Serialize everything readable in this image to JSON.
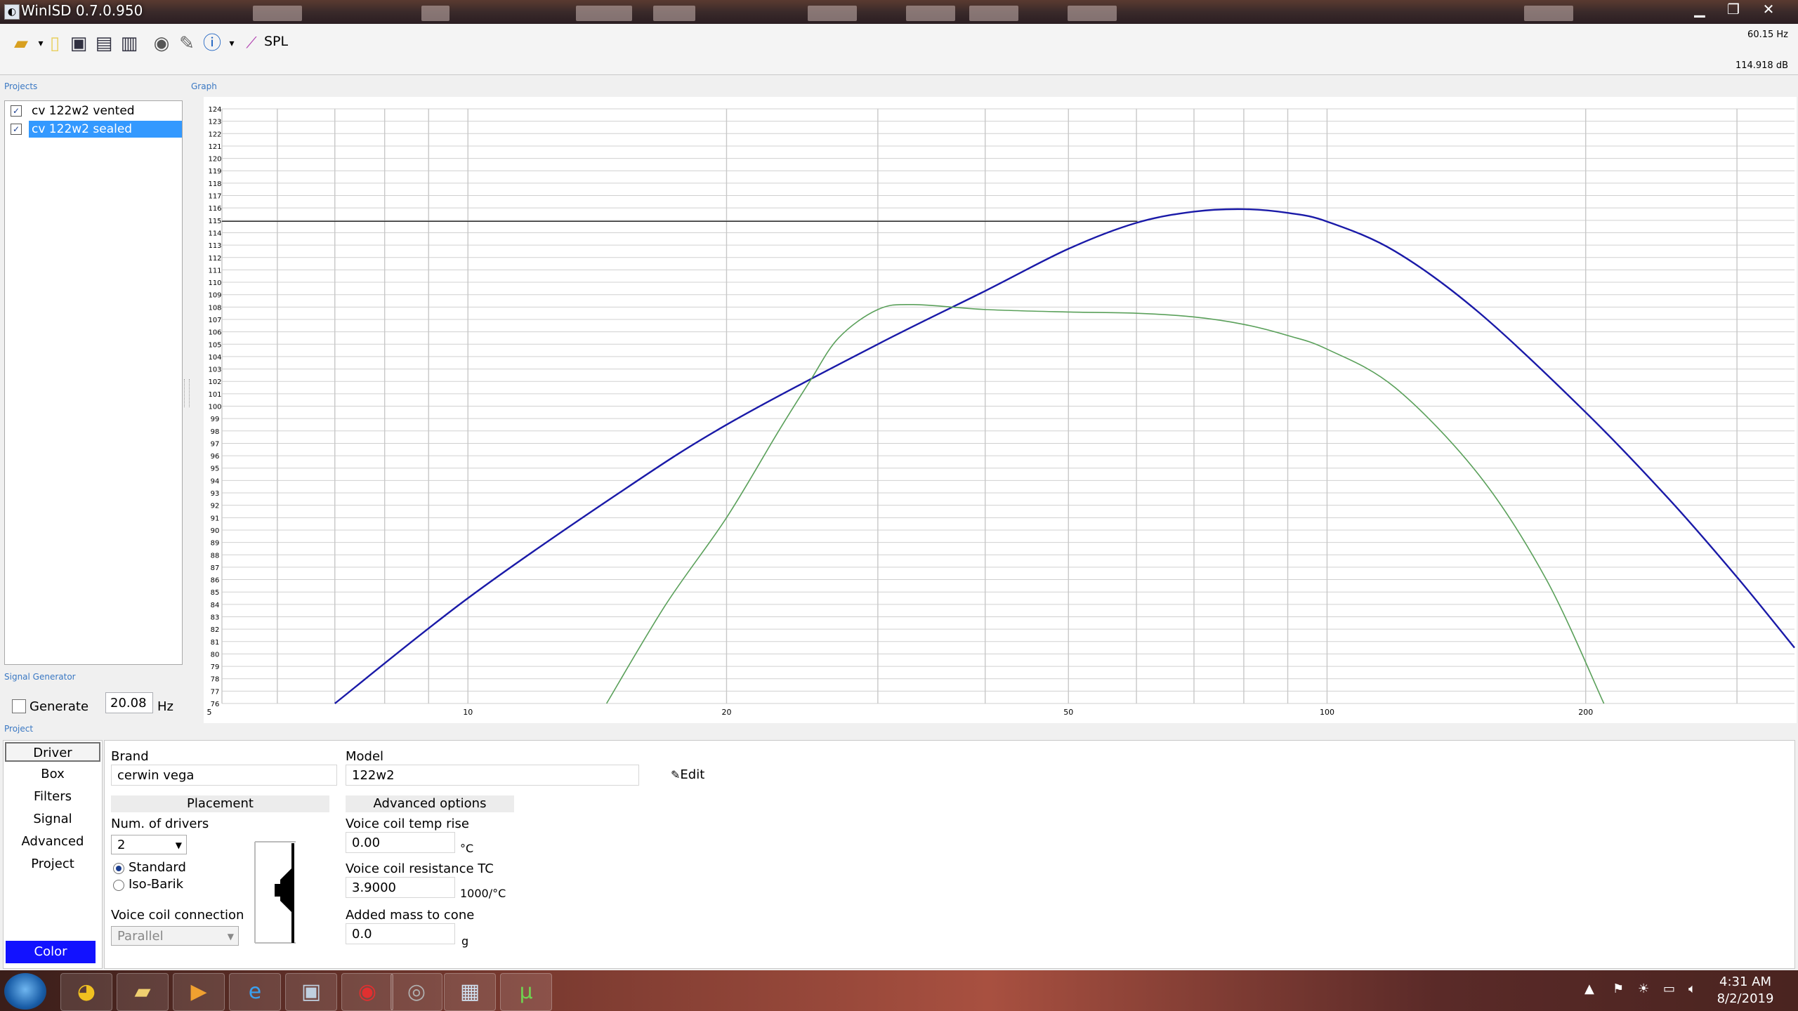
{
  "window": {
    "title": "WinISD 0.7.0.950",
    "min_icon": "minimize-icon",
    "max_icon": "maximize-icon",
    "close_icon": "close-icon"
  },
  "toolbar": {
    "icons": [
      "open-folder-icon",
      "new-document-icon",
      "save-icon",
      "save-as-icon",
      "save-all-icon",
      "driver-icon",
      "tools-icon",
      "info-icon",
      "spl-graph-icon"
    ],
    "graph_label": "SPL",
    "freq_readout": "60.15 Hz",
    "db_readout": "114.918 dB"
  },
  "projects": {
    "section_label": "Projects",
    "items": [
      {
        "name": "cv 122w2 vented",
        "checked": true,
        "selected": false
      },
      {
        "name": "cv 122w2 sealed",
        "checked": true,
        "selected": true
      }
    ]
  },
  "graph": {
    "section_label": "Graph"
  },
  "chart_data": {
    "type": "line",
    "xscale": "log",
    "xlim": [
      5,
      350
    ],
    "ylim": [
      76,
      124
    ],
    "x_tick_labels": [
      "5",
      "10",
      "20",
      "50",
      "100",
      "200"
    ],
    "y_tick_labels": [
      "124",
      "123",
      "122",
      "121",
      "120",
      "119",
      "118",
      "117",
      "116",
      "115",
      "114",
      "113",
      "112",
      "111",
      "110",
      "109",
      "108",
      "107",
      "106",
      "105",
      "104",
      "103",
      "102",
      "101",
      "100",
      "99",
      "98",
      "97",
      "96",
      "95",
      "94",
      "93",
      "92",
      "91",
      "90",
      "89",
      "88",
      "87",
      "86",
      "85",
      "84",
      "83",
      "82",
      "81",
      "80",
      "79",
      "78",
      "77",
      "76"
    ],
    "cursor": {
      "x": 60.15,
      "y": 114.918
    },
    "series": [
      {
        "color": "#1a1aa8",
        "x": [
          7,
          10,
          15,
          20,
          30,
          40,
          50,
          60,
          70,
          80,
          90,
          100,
          120,
          150,
          200,
          250,
          300,
          350
        ],
        "y": [
          76,
          84.5,
          93,
          98.5,
          105,
          109.3,
          112.7,
          114.8,
          115.7,
          115.9,
          115.6,
          114.9,
          112.5,
          107.6,
          99.5,
          92.5,
          86.2,
          80.5
        ]
      },
      {
        "color": "#5aa05a",
        "x": [
          14.5,
          17,
          20,
          23,
          25,
          27,
          30,
          33,
          40,
          50,
          60,
          70,
          80,
          90,
          100,
          120,
          150,
          180,
          210
        ],
        "y": [
          76,
          84,
          91,
          98,
          102,
          105.5,
          107.8,
          108.2,
          107.8,
          107.6,
          107.5,
          107.2,
          106.6,
          105.7,
          104.6,
          101.5,
          94.5,
          86,
          76
        ]
      }
    ]
  },
  "signal_generator": {
    "section_label": "Signal Generator",
    "generate_label": "Generate",
    "checked": false,
    "value": "20.08",
    "unit": "Hz"
  },
  "project": {
    "section_label": "Project",
    "nav": [
      "Driver",
      "Box",
      "Filters",
      "Signal",
      "Advanced",
      "Project"
    ],
    "active_nav": "Driver",
    "color_button": "Color",
    "color_value": "#1212ff",
    "brand_label": "Brand",
    "brand_value": "cerwin vega",
    "model_label": "Model",
    "model_value": "122w2",
    "edit_label": "Edit",
    "placement_header": "Placement",
    "num_drivers_label": "Num. of drivers",
    "num_drivers_value": "2",
    "placement_options": [
      "Standard",
      "Iso-Barik"
    ],
    "placement_selected": "Standard",
    "vc_connection_label": "Voice coil connection",
    "vc_connection_value": "Parallel",
    "advanced_header": "Advanced options",
    "vc_temp_rise_label": "Voice coil temp rise",
    "vc_temp_rise_value": "0.00",
    "vc_temp_rise_unit": "°C",
    "vc_resistance_tc_label": "Voice coil resistance TC",
    "vc_resistance_tc_value": "3.9000",
    "vc_resistance_tc_unit": "1000/°C",
    "added_mass_label": "Added mass to cone",
    "added_mass_value": "0.0",
    "added_mass_unit": "g"
  },
  "taskbar": {
    "apps": [
      "chrome-icon",
      "file-explorer-icon",
      "media-player-icon",
      "internet-explorer-icon",
      "remote-desktop-icon",
      "ev-app-icon",
      "speaker-app-icon",
      "calculator-icon",
      "utorrent-icon"
    ],
    "clock_time": "4:31 AM",
    "clock_date": "8/2/2019"
  }
}
